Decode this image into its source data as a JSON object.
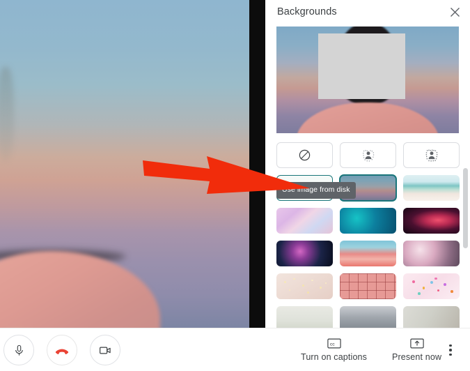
{
  "panel": {
    "title": "Backgrounds",
    "close_icon": "close-icon",
    "tooltip": "Use image from disk",
    "self_preview": {
      "alt": "self-view-preview",
      "redaction": "face-redaction-box"
    },
    "effect_options": [
      {
        "name": "turn-off-background",
        "icon": "no-background-slash-icon"
      },
      {
        "name": "slightly-blur-background",
        "icon": "slight-blur-person-icon"
      },
      {
        "name": "blur-background",
        "icon": "full-blur-person-icon"
      }
    ],
    "add_tile": {
      "label": "+",
      "name": "upload-custom-background",
      "icon": "plus-icon"
    },
    "backgrounds": [
      {
        "name": "sunset-sky",
        "style": "bg-sunset",
        "selected": true
      },
      {
        "name": "tropical-beach",
        "style": "bg-beach",
        "selected": false
      },
      {
        "name": "pink-clouds",
        "style": "bg-clouds",
        "selected": false
      },
      {
        "name": "teal-waves",
        "style": "bg-waves",
        "selected": false
      },
      {
        "name": "red-nebula",
        "style": "bg-nebula",
        "selected": false
      },
      {
        "name": "fireworks",
        "style": "bg-firework",
        "selected": false
      },
      {
        "name": "spring-flowers",
        "style": "bg-flowers",
        "selected": false
      },
      {
        "name": "cherry-blossom",
        "style": "bg-blossom",
        "selected": false
      },
      {
        "name": "cream-sparkle",
        "style": "bg-cream",
        "selected": false
      },
      {
        "name": "pink-tile-grid",
        "style": "bg-grid",
        "selected": false
      },
      {
        "name": "pink-confetti",
        "style": "bg-confetti",
        "selected": false
      },
      {
        "name": "bright-office",
        "style": "bg-room1",
        "selected": false
      },
      {
        "name": "modern-hall",
        "style": "bg-room2",
        "selected": false
      },
      {
        "name": "living-room",
        "style": "bg-room3",
        "selected": false
      }
    ],
    "scrollbar": "panel-scrollbar"
  },
  "stage": {
    "name": "self-video-feed",
    "annotation": "red-pointer-arrow",
    "annotation_color": "#f12c0b"
  },
  "bottom_bar": {
    "call_controls": [
      {
        "name": "microphone-button",
        "icon": "microphone-icon"
      },
      {
        "name": "leave-call-button",
        "icon": "hangup-phone-icon"
      },
      {
        "name": "camera-button",
        "icon": "video-camera-icon"
      }
    ],
    "captions": {
      "label": "Turn on captions",
      "icon": "cc-icon"
    },
    "present": {
      "label": "Present now",
      "icon": "present-arrow-icon"
    },
    "more": {
      "name": "more-options-button",
      "icon": "more-vertical-icon"
    }
  },
  "colors": {
    "selection_teal": "#19757a",
    "tooltip_bg": "#5f6368",
    "text": "#3c4043",
    "hangup_red": "#ea4335",
    "arrow_red": "#f12c0b"
  }
}
